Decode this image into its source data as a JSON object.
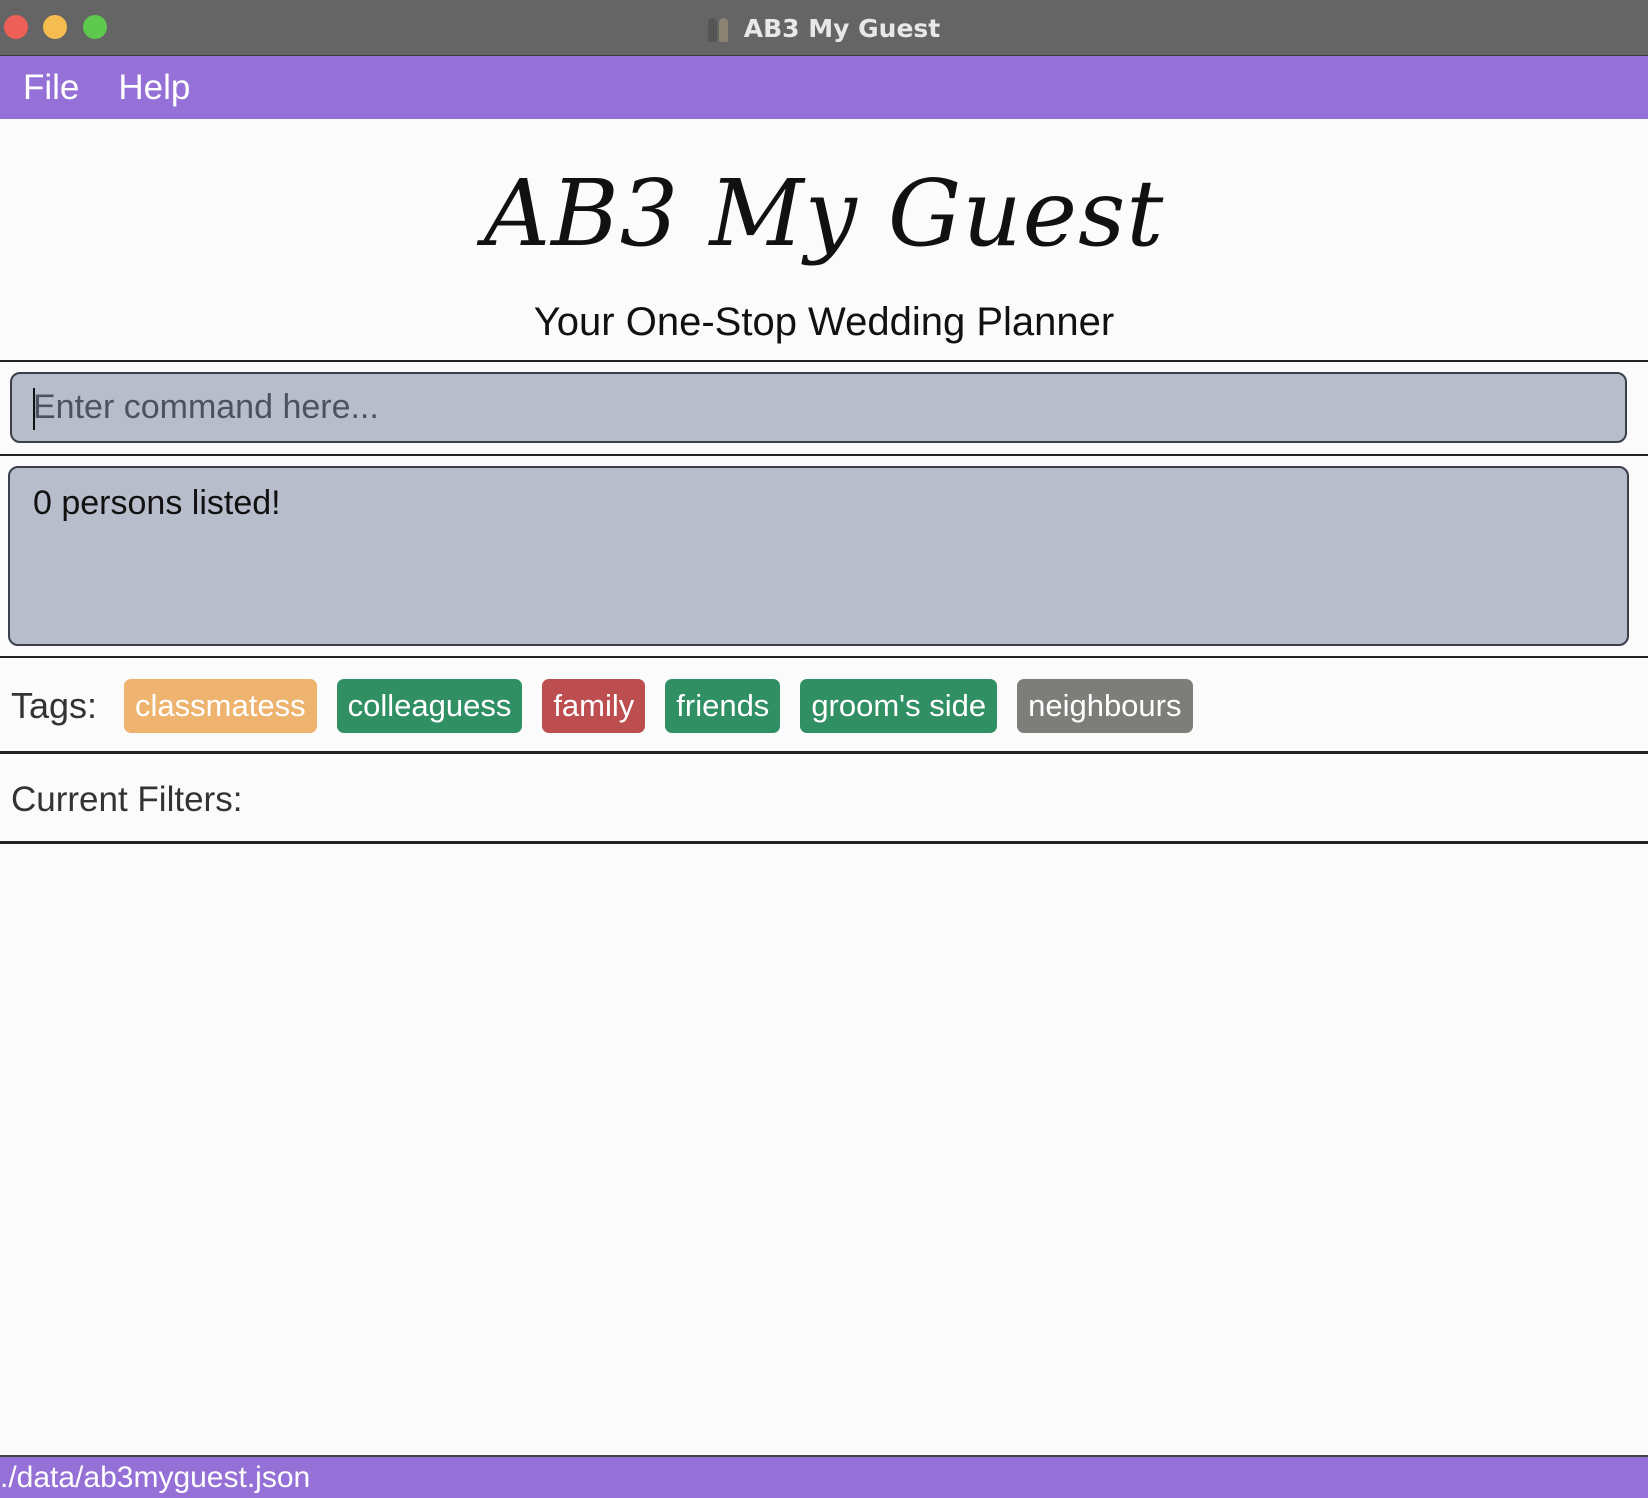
{
  "window": {
    "title": "AB3 My Guest"
  },
  "menu": {
    "items": [
      "File",
      "Help"
    ]
  },
  "header": {
    "title": "AB3 My Guest",
    "subtitle": "Your One-Stop Wedding Planner"
  },
  "command": {
    "placeholder": "Enter command here..."
  },
  "result": {
    "message": "0 persons listed!"
  },
  "tags": {
    "label": "Tags:",
    "items": [
      {
        "label": "classmatess",
        "color": "#eeb36e"
      },
      {
        "label": "colleaguess",
        "color": "#319063"
      },
      {
        "label": "family",
        "color": "#bc4e50"
      },
      {
        "label": "friends",
        "color": "#319063"
      },
      {
        "label": "groom's side",
        "color": "#319063"
      },
      {
        "label": "neighbours",
        "color": "#7d7d7a"
      }
    ]
  },
  "filters": {
    "label": "Current Filters:"
  },
  "status": {
    "file_path": "./data/ab3myguest.json"
  },
  "colors": {
    "accent": "#9570d6",
    "box": "#b7bdcb"
  }
}
